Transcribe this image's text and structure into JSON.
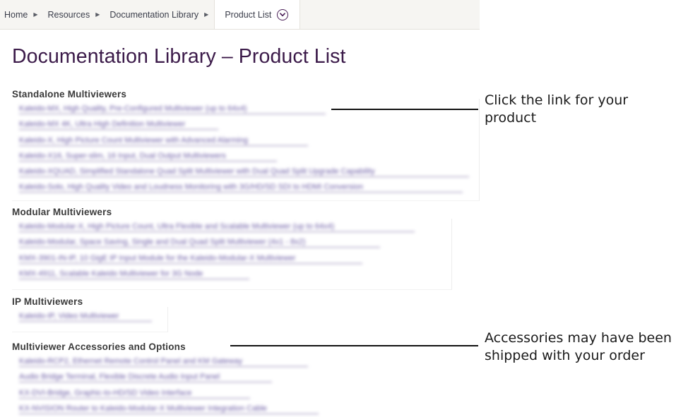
{
  "breadcrumb": {
    "items": [
      "Home",
      "Resources",
      "Documentation Library"
    ],
    "active": "Product List",
    "separator": "▶"
  },
  "page": {
    "title": "Documentation Library – Product List"
  },
  "sections": [
    {
      "heading": "Standalone Multiviewers",
      "links": [
        "Kaleido-MX, High Quality, Pre-Configured Multiviewer (up to 64x4)",
        "Kaleido-MX 4K, Ultra High Definition Multiviewer",
        "Kaleido-X, High Picture Count Multiviewer with Advanced Alarming",
        "Kaleido-X16, Super-slim, 16 Input, Dual Output Multiviewers",
        "Kaleido-XQUAD, Simplified Standalone Quad Split Multiviewer with Dual Quad Split Upgrade Capability",
        "Kaleido-Solo, High Quality Video and Loudness Monitoring with 3G/HD/SD SDI to HDMI Conversion"
      ]
    },
    {
      "heading": "Modular Multiviewers",
      "links": [
        "Kaleido-Modular-X, High Picture Count, Ultra Flexible and Scalable Multiviewer (up to 64x4)",
        "Kaleido-Modular, Space Saving, Single and Dual Quad Split Multiviewer (4x1 - 8x2)",
        "KMX-3901-IN-IP, 10 GigE IP Input Module for the Kaleido-Modular-X Multiviewer",
        "KMX-4911, Scalable Kaleido Multiviewer for 3G Node"
      ]
    },
    {
      "heading": "IP Multiviewers",
      "links": [
        "Kaleido-IP, Video Multiviewer"
      ]
    },
    {
      "heading": "Multiviewer Accessories and Options",
      "links": [
        "Kaleido-RCP2, Ethernet Remote Control Panel and KM Gateway",
        "Audio Bridge Terminal, Flexible Discrete Audio Input Panel",
        "KX-DVI-Bridge, Graphic-to-HD/SD Video Interface",
        "KX-NVISION Router to Kaleido-Modular-X Multiviewer Integration Cable"
      ]
    }
  ],
  "callouts": [
    {
      "text": "Click the link for your product"
    },
    {
      "text": "Accessories may have been shipped with your order"
    }
  ]
}
